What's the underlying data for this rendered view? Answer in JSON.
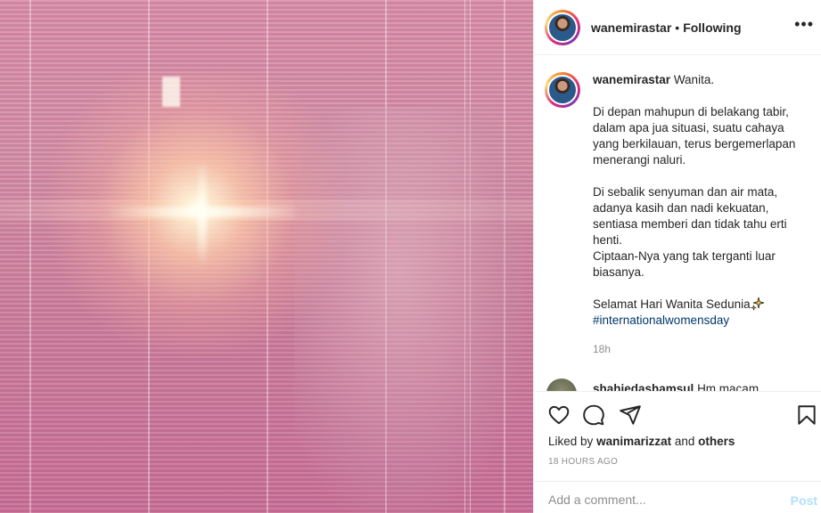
{
  "post": {
    "author": "wanemirastar",
    "follow_separator": "•",
    "follow_status": "Following",
    "more_label": "•••"
  },
  "caption": {
    "username": "wanemirastar",
    "title": "Wanita.",
    "paragraph1": "Di depan mahupun di belakang tabir, dalam apa jua situasi, suatu cahaya yang berkilauan, terus bergemerlapan menerangi naluri.",
    "paragraph2": "Di sebalik senyuman dan air mata, adanya kasih dan nadi kekuatan, sentiasa memberi dan tidak tahu erti henti.",
    "paragraph3": "Ciptaan-Nya yang tak terganti luar biasanya.",
    "greeting": "Selamat Hari Wanita Sedunia",
    "hashtag": "#internationalwomensday",
    "time_ago": "18h"
  },
  "next_comment": {
    "username": "shahiedashamsul",
    "text": "Hm macam"
  },
  "actions": {
    "icons": [
      "heart-icon",
      "comment-icon",
      "share-icon",
      "bookmark-icon"
    ]
  },
  "likes": {
    "prefix": "Liked by",
    "user": "wanimarizzat",
    "connector": "and",
    "others": "others"
  },
  "timestamp": "18 HOURS AGO",
  "comment_box": {
    "placeholder": "Add a comment...",
    "post_label": "Post"
  },
  "colors": {
    "link": "#00376b",
    "muted": "#8e8e8e",
    "post_disabled": "#b2dffc"
  }
}
